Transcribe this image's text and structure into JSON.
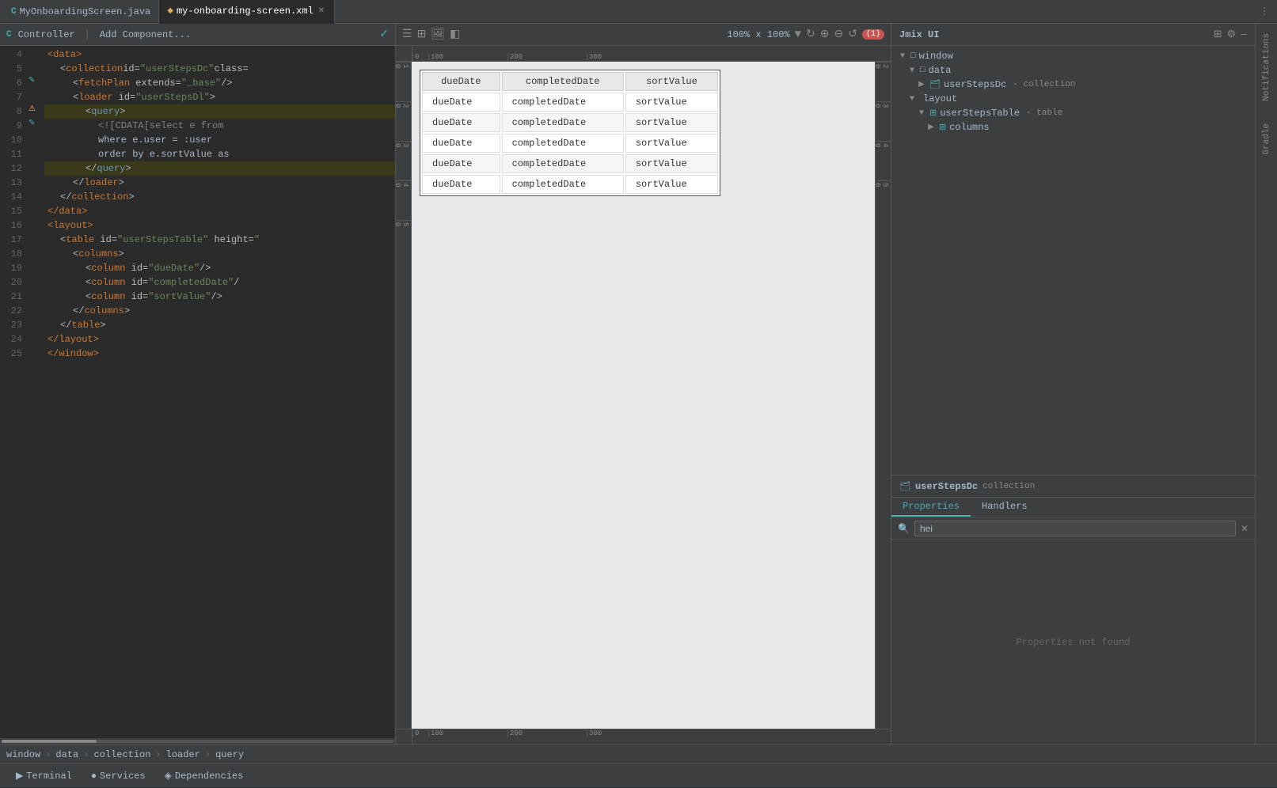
{
  "tabs": [
    {
      "id": "java",
      "label": "MyOnboardingScreen.java",
      "icon": "C",
      "active": false,
      "closeable": false
    },
    {
      "id": "xml",
      "label": "my-onboarding-screen.xml",
      "icon": "XML",
      "active": true,
      "closeable": true
    }
  ],
  "editor": {
    "toolbar": {
      "icons": [
        "✓"
      ]
    },
    "lines": [
      {
        "num": 4,
        "indent": 0,
        "content": "<data>",
        "type": "tag",
        "hasBreakpoint": false,
        "hasGutter": false
      },
      {
        "num": 5,
        "indent": 1,
        "content": "<collection id=\"userStepsDc\" class=",
        "type": "mixed",
        "hasBreakpoint": false,
        "hasGutter": false
      },
      {
        "num": 6,
        "indent": 2,
        "content": "<fetchPlan extends=\"_base\"/>",
        "type": "mixed",
        "hasBreakpoint": false,
        "hasGutter": true
      },
      {
        "num": 7,
        "indent": 2,
        "content": "<loader id=\"userStepsDl\">",
        "type": "mixed",
        "hasBreakpoint": false,
        "hasGutter": false
      },
      {
        "num": 8,
        "indent": 3,
        "content": "<query>",
        "type": "tag-selected",
        "hasBreakpoint": true,
        "hasGutter": true
      },
      {
        "num": 9,
        "indent": 4,
        "content": "<![CDATA[select e from",
        "type": "comment",
        "hasBreakpoint": false,
        "hasGutter": true
      },
      {
        "num": 10,
        "indent": 4,
        "content": "where e.user = :user",
        "type": "plain",
        "hasBreakpoint": false,
        "hasGutter": false
      },
      {
        "num": 11,
        "indent": 4,
        "content": "order by e.sortValue as",
        "type": "plain",
        "hasBreakpoint": false,
        "hasGutter": false
      },
      {
        "num": 12,
        "indent": 3,
        "content": "</query>",
        "type": "tag-selected",
        "hasBreakpoint": false,
        "hasGutter": false
      },
      {
        "num": 13,
        "indent": 2,
        "content": "</loader>",
        "type": "tag",
        "hasBreakpoint": false,
        "hasGutter": false
      },
      {
        "num": 14,
        "indent": 1,
        "content": "</collection>",
        "type": "tag",
        "hasBreakpoint": false,
        "hasGutter": false
      },
      {
        "num": 15,
        "indent": 0,
        "content": "</data>",
        "type": "tag",
        "hasBreakpoint": false,
        "hasGutter": false
      },
      {
        "num": 16,
        "indent": 0,
        "content": "<layout>",
        "type": "tag",
        "hasBreakpoint": false,
        "hasGutter": false
      },
      {
        "num": 17,
        "indent": 1,
        "content": "<table id=\"userStepsTable\" height=\"",
        "type": "mixed",
        "hasBreakpoint": false,
        "hasGutter": false
      },
      {
        "num": 18,
        "indent": 2,
        "content": "<columns>",
        "type": "tag",
        "hasBreakpoint": false,
        "hasGutter": false
      },
      {
        "num": 19,
        "indent": 3,
        "content": "<column id=\"dueDate\"/>",
        "type": "mixed",
        "hasBreakpoint": false,
        "hasGutter": false
      },
      {
        "num": 20,
        "indent": 3,
        "content": "<column id=\"completedDate\"/",
        "type": "mixed",
        "hasBreakpoint": false,
        "hasGutter": false
      },
      {
        "num": 21,
        "indent": 3,
        "content": "<column id=\"sortValue\"/>",
        "type": "mixed",
        "hasBreakpoint": false,
        "hasGutter": false
      },
      {
        "num": 22,
        "indent": 2,
        "content": "</columns>",
        "type": "tag",
        "hasBreakpoint": false,
        "hasGutter": false
      },
      {
        "num": 23,
        "indent": 1,
        "content": "</table>",
        "type": "tag",
        "hasBreakpoint": false,
        "hasGutter": false
      },
      {
        "num": 24,
        "indent": 0,
        "content": "</layout>",
        "type": "tag",
        "hasBreakpoint": false,
        "hasGutter": false
      },
      {
        "num": 25,
        "indent": 0,
        "content": "</window>",
        "type": "tag",
        "hasBreakpoint": false,
        "hasGutter": false
      }
    ]
  },
  "preview": {
    "zoom": "100% x 100%",
    "warning": "(1)",
    "table": {
      "headers": [
        "dueDate",
        "completedDate",
        "sortValue"
      ],
      "rows": [
        [
          "dueDate",
          "completedDate",
          "sortValue"
        ],
        [
          "dueDate",
          "completedDate",
          "sortValue"
        ],
        [
          "dueDate",
          "completedDate",
          "sortValue"
        ],
        [
          "dueDate",
          "completedDate",
          "sortValue"
        ],
        [
          "dueDate",
          "completedDate",
          "sortValue"
        ]
      ]
    }
  },
  "jmix": {
    "title": "Jmix UI",
    "tree": {
      "items": [
        {
          "label": "window",
          "type": "",
          "indent": 0,
          "expanded": true,
          "icon": "□"
        },
        {
          "label": "data",
          "type": "",
          "indent": 1,
          "expanded": true,
          "icon": "□"
        },
        {
          "label": "userStepsDc",
          "type": "- collection",
          "indent": 2,
          "expanded": false,
          "icon": "🗂"
        },
        {
          "label": "layout",
          "type": "",
          "indent": 1,
          "expanded": true,
          "icon": ""
        },
        {
          "label": "userStepsTable",
          "type": "- table",
          "indent": 2,
          "expanded": true,
          "icon": "⊞"
        },
        {
          "label": "columns",
          "type": "",
          "indent": 3,
          "expanded": false,
          "icon": "⊞"
        }
      ]
    },
    "properties": {
      "title": "userStepsDc",
      "type": "collection",
      "tabs": [
        "Properties",
        "Handlers"
      ],
      "activeTab": "Properties",
      "search": {
        "placeholder": "",
        "value": "hei"
      },
      "noResultsMessage": "Properties not found"
    }
  },
  "breadcrumb": {
    "items": [
      "window",
      "data",
      "collection",
      "loader",
      "query"
    ]
  },
  "bottomTabs": [
    {
      "label": "Terminal",
      "icon": "▶"
    },
    {
      "label": "Services",
      "icon": "●"
    },
    {
      "label": "Dependencies",
      "icon": "◈"
    }
  ],
  "sidePanel": {
    "labels": [
      "Notifications",
      "Gradle"
    ]
  }
}
